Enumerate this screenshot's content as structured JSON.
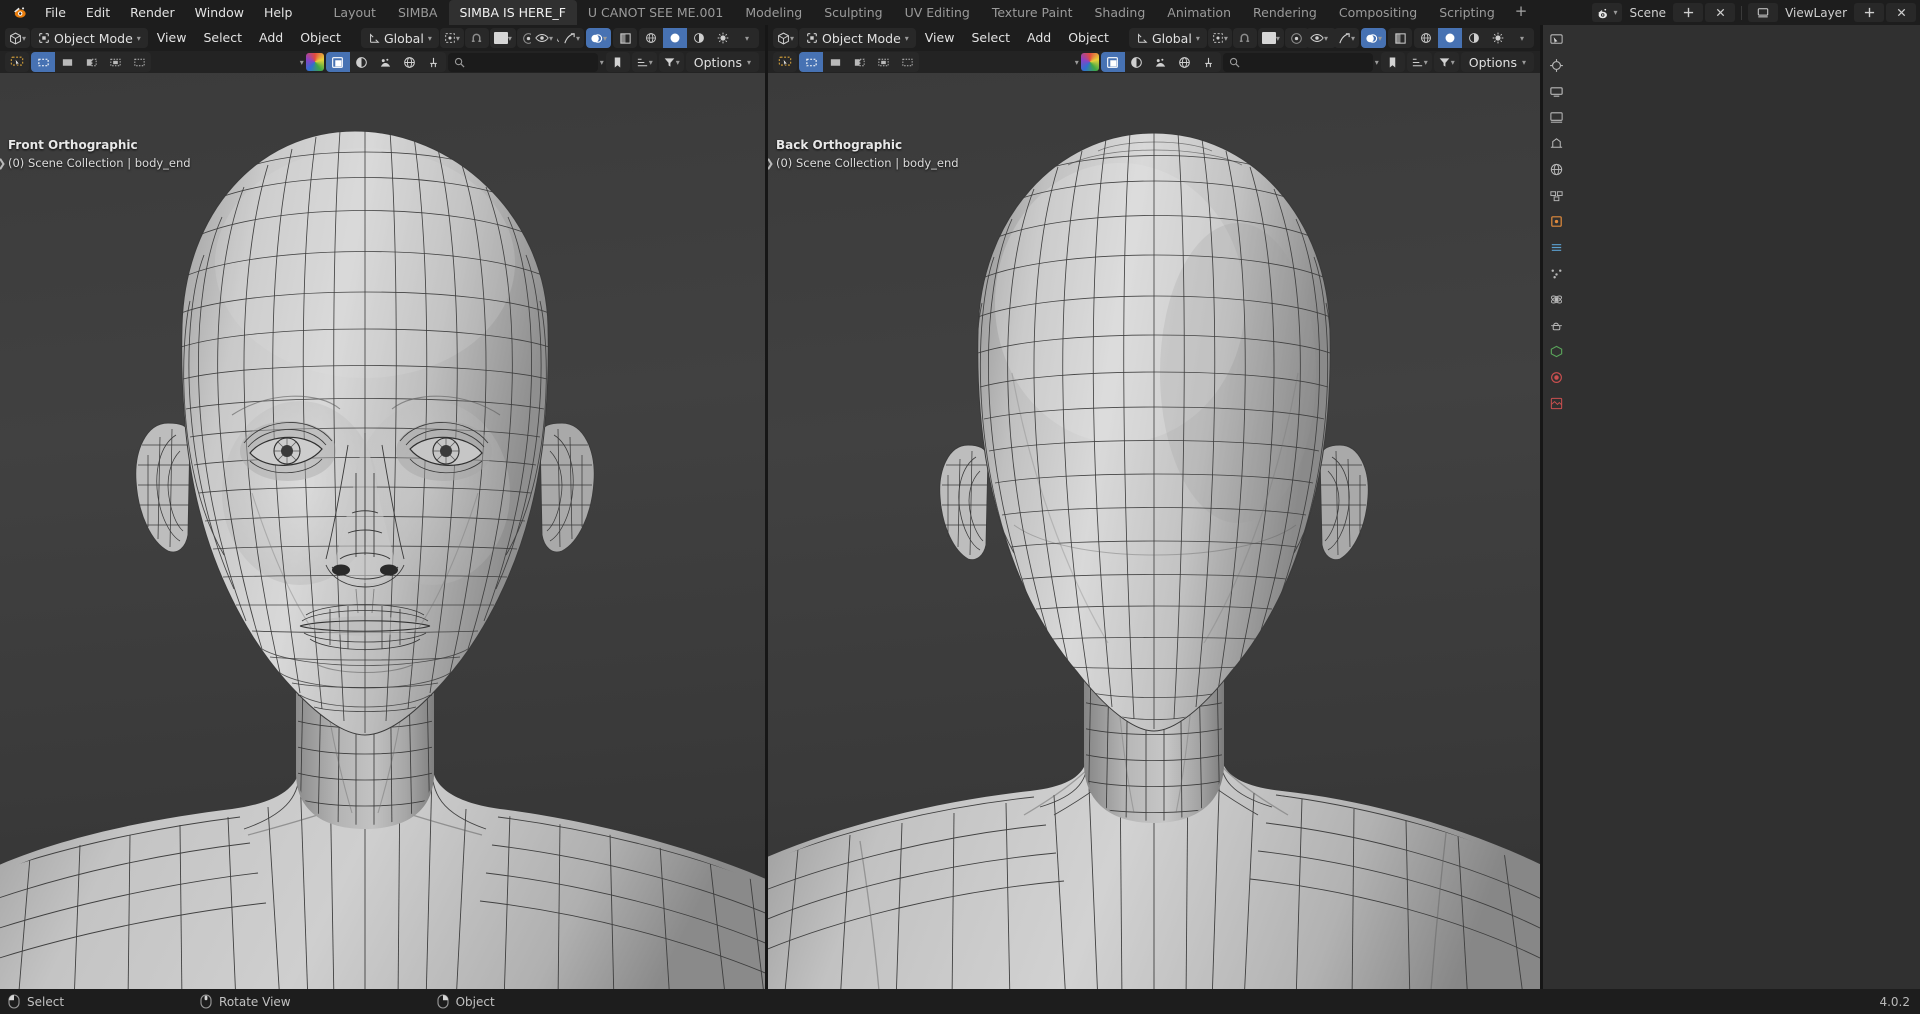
{
  "app": {
    "title": "Blender",
    "version": "4.0.2"
  },
  "topbar": {
    "logo_icon": "blender-logo-icon",
    "menus": [
      "File",
      "Edit",
      "Render",
      "Window",
      "Help"
    ],
    "workspace_tabs": [
      {
        "label": "Layout",
        "active": false
      },
      {
        "label": "SIMBA",
        "active": false
      },
      {
        "label": "SIMBA IS HERE_F",
        "active": true
      },
      {
        "label": "U CANOT SEE ME.001",
        "active": false
      },
      {
        "label": "Modeling",
        "active": false
      },
      {
        "label": "Sculpting",
        "active": false
      },
      {
        "label": "UV Editing",
        "active": false
      },
      {
        "label": "Texture Paint",
        "active": false
      },
      {
        "label": "Shading",
        "active": false
      },
      {
        "label": "Animation",
        "active": false
      },
      {
        "label": "Rendering",
        "active": false
      },
      {
        "label": "Compositing",
        "active": false
      },
      {
        "label": "Scripting",
        "active": false
      }
    ],
    "add_workspace_label": "+",
    "scene_icon": "scene-icon",
    "scene_name": "Scene",
    "new_scene_icon": "new-scene-icon",
    "unlink_scene_icon": "unlink-scene-icon",
    "viewlayer_icon": "viewlayer-icon",
    "viewlayer_name": "ViewLayer",
    "new_viewlayer_icon": "add-viewlayer-icon",
    "remove_viewlayer_icon": "remove-viewlayer-icon"
  },
  "viewport_left": {
    "editor_type_icon": "editor-type-3dviewport-icon",
    "mode_icon": "object-mode-icon",
    "mode_label": "Object Mode",
    "menus": [
      "View",
      "Select",
      "Add",
      "Object"
    ],
    "transform_orientation_icon": "orientation-icon",
    "transform_orientation": "Global",
    "snap_icon": "snap-magnet-icon",
    "snap_target_icon": "snap-target-icon",
    "proportional_icon": "proportional-edit-icon",
    "proportional_falloff_icon": "falloff-smooth-icon",
    "visibility_icon": "show-hide-icon",
    "gizmo_icon": "gizmo-icon",
    "overlays_icon": "overlays-icon",
    "xray_icon": "xray-toggle-icon",
    "shading_modes": [
      "wireframe",
      "solid",
      "material-preview",
      "rendered"
    ],
    "shading_active": "solid",
    "toolbar": {
      "active_tool_icon": "tweak-tool-icon",
      "select_modes": [
        "select-box-icon",
        "select-circle-icon",
        "select-lasso-icon",
        "select-extend-icon",
        "select-intersect-icon"
      ],
      "active_select_mode": "select-box-icon"
    },
    "subheader": {
      "colorwheel_icon": "color-swatch-icon",
      "buttons": [
        "object-types-icon",
        "wireframe-shade-icon",
        "texture-icon",
        "world-icon",
        "tool-icon"
      ],
      "search_placeholder": "",
      "search_icon": "search-icon",
      "bookmark_icon": "bookmark-icon",
      "filter_icon": "filter-icon",
      "sort_icon": "sort-icon",
      "options_label": "Options"
    },
    "overlay": {
      "view_name": "Front Orthographic",
      "collection_object": "(0) Scene Collection | body_end"
    }
  },
  "viewport_right": {
    "editor_type_icon": "editor-type-3dviewport-icon",
    "mode_icon": "object-mode-icon",
    "mode_label": "Object Mode",
    "menus": [
      "View",
      "Select",
      "Add",
      "Object"
    ],
    "transform_orientation_icon": "orientation-icon",
    "transform_orientation": "Global",
    "snap_icon": "snap-magnet-icon",
    "snap_target_icon": "snap-target-icon",
    "proportional_icon": "proportional-edit-icon",
    "proportional_falloff_icon": "falloff-smooth-icon",
    "visibility_icon": "show-hide-icon",
    "gizmo_icon": "gizmo-icon",
    "overlays_icon": "overlays-icon",
    "xray_icon": "xray-toggle-icon",
    "shading_modes": [
      "wireframe",
      "solid",
      "material-preview",
      "rendered"
    ],
    "shading_active": "solid",
    "toolbar": {
      "active_tool_icon": "tweak-tool-icon",
      "select_modes": [
        "select-box-icon",
        "select-circle-icon",
        "select-lasso-icon",
        "select-extend-icon",
        "select-intersect-icon"
      ],
      "active_select_mode": "select-box-icon"
    },
    "subheader": {
      "colorwheel_icon": "color-swatch-icon",
      "buttons": [
        "object-types-icon",
        "wireframe-shade-icon",
        "texture-icon",
        "world-icon",
        "tool-icon"
      ],
      "search_placeholder": "",
      "search_icon": "search-icon",
      "bookmark_icon": "bookmark-icon",
      "filter_icon": "filter-icon",
      "sort_icon": "sort-icon",
      "options_label": "Options"
    },
    "overlay": {
      "view_name": "Back Orthographic",
      "collection_object": "(0) Scene Collection | body_end"
    }
  },
  "properties_editor": {
    "tabs": [
      "tool-tab-icon",
      "render-tab-icon",
      "output-tab-icon",
      "viewlayer-tab-icon",
      "scene-tab-icon",
      "world-tab-icon",
      "collection-tab-icon",
      "object-tab-icon",
      "modifier-tab-icon",
      "particles-tab-icon",
      "physics-tab-icon",
      "constraints-tab-icon",
      "data-tab-icon",
      "material-tab-icon",
      "texture-tab-icon"
    ],
    "active_tab": "object-tab-icon"
  },
  "statusbar": {
    "items": [
      {
        "icon": "mouse-left-icon",
        "label": "Select"
      },
      {
        "icon": "mouse-middle-icon",
        "label": "Rotate View"
      },
      {
        "icon": "mouse-right-icon",
        "label": "Object"
      }
    ],
    "version": "4.0.2"
  },
  "colors": {
    "accent_blue": "#4772b3",
    "window_bg": "#1d1d1d",
    "editor_bg": "#303030",
    "header_bg": "#1d1d1d",
    "viewport_top": "#3b3b3b",
    "viewport_bottom": "#333333",
    "mesh_light": "#cfcfcf",
    "wire_dark": "#2b2b2b"
  }
}
